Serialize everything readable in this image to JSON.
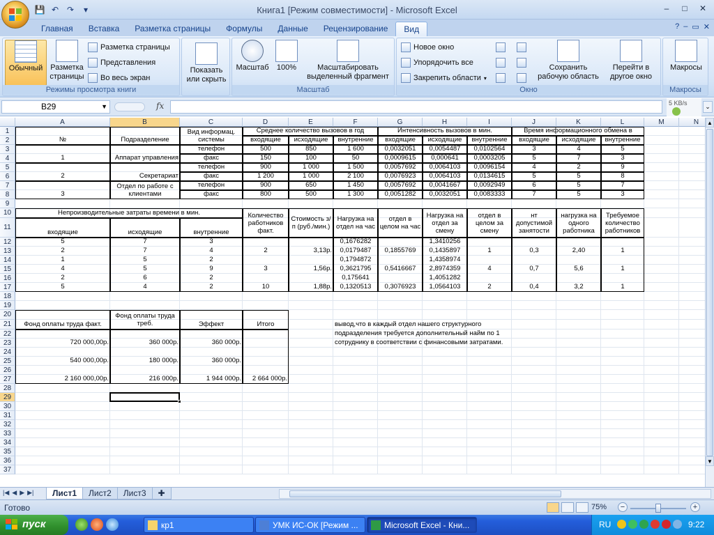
{
  "window": {
    "title": "Книга1  [Режим совместимости] - Microsoft Excel",
    "controls": {
      "minimize": "–",
      "maximize": "□",
      "close": "✕"
    },
    "doc_controls": {
      "minimize": "–",
      "restore": "▭",
      "close": "✕"
    }
  },
  "qat": {
    "save": "💾",
    "undo": "↶",
    "redo": "↷",
    "customize": "▾"
  },
  "ribbon": {
    "tabs": [
      "Главная",
      "Вставка",
      "Разметка страницы",
      "Формулы",
      "Данные",
      "Рецензирование",
      "Вид"
    ],
    "active_tab": "Вид",
    "help": "?",
    "groups": {
      "views": {
        "label": "Режимы просмотра книги",
        "normal": "Обычный",
        "page_layout": "Разметка страницы",
        "page_break": "Разметка страницы",
        "custom_views": "Представления",
        "full_screen": "Во весь экран"
      },
      "show": {
        "label": "Показать или скрыть"
      },
      "zoom": {
        "label": "Масштаб",
        "zoom": "Масштаб",
        "hundred": "100%",
        "fit": "Масштабировать выделенный фрагмент"
      },
      "window": {
        "label": "Окно",
        "new_window": "Новое окно",
        "arrange": "Упорядочить все",
        "freeze": "Закрепить области",
        "save_workspace": "Сохранить рабочую область",
        "switch": "Перейти в другое окно"
      },
      "macros": {
        "label": "Макросы",
        "macros": "Макросы"
      }
    }
  },
  "formula_bar": {
    "name_box": "B29",
    "fx": "fx",
    "value": "",
    "net_speed": "5 KB/s"
  },
  "columns": [
    "A",
    "B",
    "C",
    "D",
    "E",
    "F",
    "G",
    "H",
    "I",
    "J",
    "K",
    "L",
    "M",
    "N"
  ],
  "rows": [
    "1",
    "2",
    "3",
    "4",
    "5",
    "6",
    "7",
    "8",
    "9",
    "10",
    "11",
    "12",
    "13",
    "14",
    "15",
    "16",
    "17",
    "18",
    "19",
    "20",
    "21",
    "22",
    "23",
    "24",
    "25",
    "26",
    "27",
    "28",
    "29",
    "30",
    "31",
    "32",
    "33",
    "34",
    "35",
    "36",
    "37"
  ],
  "selected_cell": {
    "col": "B",
    "row": "29"
  },
  "cells": {
    "c1": "Вид информац. системы",
    "d1": "Среднее количество вызовов в год",
    "g1": "Интенсивность вызовов в мин.",
    "j1": "Время информационного обмена в",
    "a2": "№",
    "b2": "Подразделение",
    "d2": "входящие",
    "e2": "исходящие",
    "f2": "внутренние",
    "g2": "входящие",
    "h2": "исходящие",
    "i2": "внутренние",
    "j2": "входящие",
    "k2": "исходящие",
    "l2": "внутренние",
    "c3": "телефон",
    "d3": "500",
    "e3": "850",
    "f3": "1 600",
    "g3": "0,0032051",
    "h3": "0,0054487",
    "i3": "0,0102564",
    "j3": "3",
    "k3": "4",
    "l3": "5",
    "a4": "1",
    "b4": "Аппарат управления",
    "c4": "факс",
    "d4": "150",
    "e4": "100",
    "f4": "50",
    "g4": "0,0009615",
    "h4": "0,000641",
    "i4": "0,0003205",
    "j4": "5",
    "k4": "7",
    "l4": "3",
    "c5": "телефон",
    "d5": "900",
    "e5": "1 000",
    "f5": "1 500",
    "g5": "0,0057692",
    "h5": "0,0064103",
    "i5": "0,0096154",
    "j5": "4",
    "k5": "2",
    "l5": "9",
    "a6": "2",
    "b6": "Секретариат",
    "c6": "факс",
    "d6": "1 200",
    "e6": "1 000",
    "f6": "2 100",
    "g6": "0,0076923",
    "h6": "0,0064103",
    "i6": "0,0134615",
    "j6": "5",
    "k6": "5",
    "l6": "8",
    "b7": "Отдел по работе с клиентами",
    "c7": "телефон",
    "d7": "900",
    "e7": "650",
    "f7": "1 450",
    "g7": "0,0057692",
    "h7": "0,0041667",
    "i7": "0,0092949",
    "j7": "6",
    "k7": "5",
    "l7": "7",
    "a8": "3",
    "c8": "факс",
    "d8": "800",
    "e8": "500",
    "f8": "1 300",
    "g8": "0,0051282",
    "h8": "0,0032051",
    "i8": "0,0083333",
    "j8": "7",
    "k8": "5",
    "l8": "3",
    "a10": "Непроизводительные затраты времени в мин.",
    "d10": "Количество работников факт.",
    "e10": "Стоимость з/п (руб./мин.)",
    "f10": "Нагрузка на отдел на час",
    "g10": "отдел в целом на час",
    "h10": "Нагрузка на отдел за смену",
    "i10": "отдел в целом за смену",
    "j10": "нт допустимой занятости",
    "k10": "нагрузка на одного работника",
    "l10": "Требуемое количество работников",
    "a11": "входящие",
    "b11": "исходящие",
    "c11": "внутренние",
    "a12": "5",
    "b12": "7",
    "c12": "3",
    "f12": "0,1676282",
    "h12": "1,3410256",
    "a13": "2",
    "b13": "7",
    "c13": "4",
    "d13": "2",
    "e13": "3,13р.",
    "f13": "0,0179487",
    "g13": "0,1855769",
    "h13": "0,1435897",
    "i13": "1",
    "j13": "0,3",
    "k13": "2,40",
    "l13": "1",
    "a14": "1",
    "b14": "5",
    "c14": "2",
    "f14": "0,1794872",
    "h14": "1,4358974",
    "a15": "4",
    "b15": "5",
    "c15": "9",
    "d15": "3",
    "e15": "1,56р.",
    "f15": "0,3621795",
    "g15": "0,5416667",
    "h15": "2,8974359",
    "i15": "4",
    "j15": "0,7",
    "k15": "5,6",
    "l15": "1",
    "a16": "2",
    "b16": "6",
    "c16": "2",
    "f16": "0,175641",
    "h16": "1,4051282",
    "a17": "5",
    "b17": "4",
    "c17": "2",
    "d17": "10",
    "e17": "1,88р.",
    "f17": "0,1320513",
    "g17": "0,3076923",
    "h17": "1,0564103",
    "i17": "2",
    "j17": "0,4",
    "k17": "3,2",
    "l17": "1",
    "b20": "Фонд оплаты труда треб.",
    "a21": "Фонд оплаты труда факт.",
    "c21": "Эффект",
    "d21": "Итого",
    "a23": "720 000,00р.",
    "b23": "360 000р.",
    "c23": "360 000р.",
    "a25": "540 000,00р.",
    "b25": "180 000р.",
    "c25": "360 000р.",
    "a27": "2 160 000,00р.",
    "b27": "216 000р.",
    "c27": "1 944 000р.",
    "d27": "2 664 000р.",
    "f21": "вывод,что в каждый отдел нашего структурного подразделения требуется дополнительный найм по 1 сотруднику  в соответствии с финансовыми затратами."
  },
  "sheets": [
    "Лист1",
    "Лист2",
    "Лист3"
  ],
  "active_sheet": "Лист1",
  "status": {
    "text": "Готово",
    "zoom": "75%",
    "zoom_fraction": 0.5
  },
  "taskbar": {
    "start": "пуск",
    "tasks": [
      {
        "label": "кр1",
        "active": false
      },
      {
        "label": "УМК ИС-ОК [Режим ...",
        "active": false
      },
      {
        "label": "Microsoft Excel - Кни...",
        "active": true
      }
    ],
    "lang": "RU",
    "clock": "9:22"
  },
  "colors": {
    "ribbon_blue": "#15428b",
    "selection_orange": "#f8d68c",
    "taskbar_blue": "#245edb",
    "start_green": "#2f8e2c"
  }
}
